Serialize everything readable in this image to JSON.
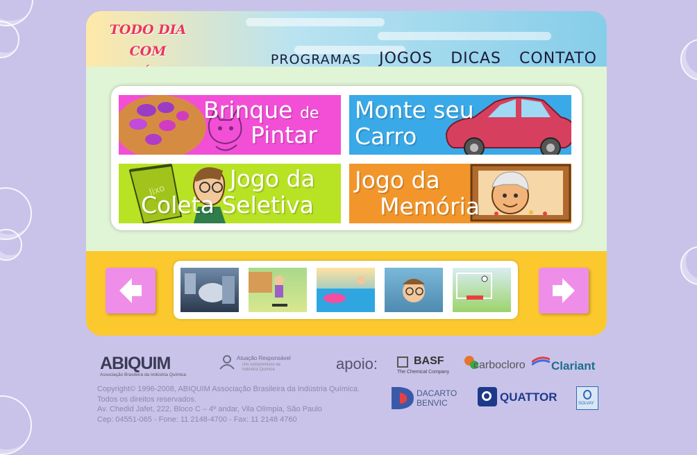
{
  "header": {
    "logo_line1": "TODO DIA COM",
    "logo_line2": "A QUÍMICA",
    "nav": [
      {
        "label": "PROGRAMAS"
      },
      {
        "label": "JOGOS"
      },
      {
        "label": "DICAS"
      },
      {
        "label": "CONTATO"
      }
    ]
  },
  "games": [
    {
      "line1": "Brinque",
      "line1_suffix": "de",
      "line2": "Pintar"
    },
    {
      "line1": "Monte seu",
      "line2": "Carro"
    },
    {
      "line1": "Jogo da",
      "line2": "Coleta Seletiva",
      "bin_label": "lixo"
    },
    {
      "line1": "Jogo da",
      "line2": "Memória"
    }
  ],
  "carousel": {
    "prev_label": "previous",
    "next_label": "next"
  },
  "sponsors": {
    "abiquim": "ABIQUIM",
    "abiquim_sub": "Associação Brasileira da Indústria Química",
    "atuacao": "Atuação Responsável",
    "atuacao_sub1": "Um compromisso da",
    "atuacao_sub2": "indústria Química",
    "apoio": "apoio:",
    "basf": "BASF",
    "basf_sub": "The Chemical Company",
    "carbocloro": "carbocloro",
    "clariant": "Clariant",
    "dacarto1": "DACARTO",
    "dacarto2": "BENVIC",
    "quattor": "QUATTOR",
    "solvay": "SOLVAY"
  },
  "footer": {
    "line1": "Copyright© 1996-2008, ABIQUIM Associação Brasileira da Indústria Química.",
    "line2": "Todos os direitos reservados.",
    "line3": "Av. Chedid Jafet, 222, Bloco C – 4º andar, Vila Olímpia, São Paulo",
    "line4": "Cep: 04551-065 - Fone: 11 2148-4700 - Fax: 11 2148 4760"
  },
  "colors": {
    "background": "#c9c3ea",
    "accent_yellow": "#fbc92e",
    "arrow_pink": "#ee8ee8",
    "logo_red": "#e8365e"
  }
}
